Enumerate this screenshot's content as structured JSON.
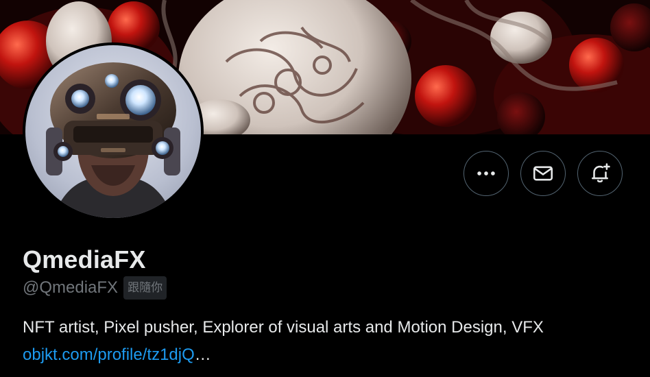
{
  "banner": {
    "description_icon": "banner-artwork"
  },
  "avatar": {
    "icon": "robot-avatar"
  },
  "actions": [
    {
      "name": "more-options-button",
      "icon": "more-horizontal-icon"
    },
    {
      "name": "message-button",
      "icon": "envelope-icon"
    },
    {
      "name": "notify-button",
      "icon": "bell-plus-icon"
    }
  ],
  "profile": {
    "display_name": "QmediaFX",
    "handle": "@QmediaFX",
    "follows_you_badge": "跟隨你",
    "bio": "NFT artist, Pixel pusher, Explorer of visual arts and Motion Design, VFX",
    "bio_link": "objkt.com/profile/tz1djQ",
    "bio_link_ellipsis": "…"
  },
  "colors": {
    "background": "#000000",
    "text_primary": "#e7e9ea",
    "text_secondary": "#71767b",
    "link": "#1d9bf0",
    "button_border": "#536471",
    "badge_bg": "#202327"
  }
}
